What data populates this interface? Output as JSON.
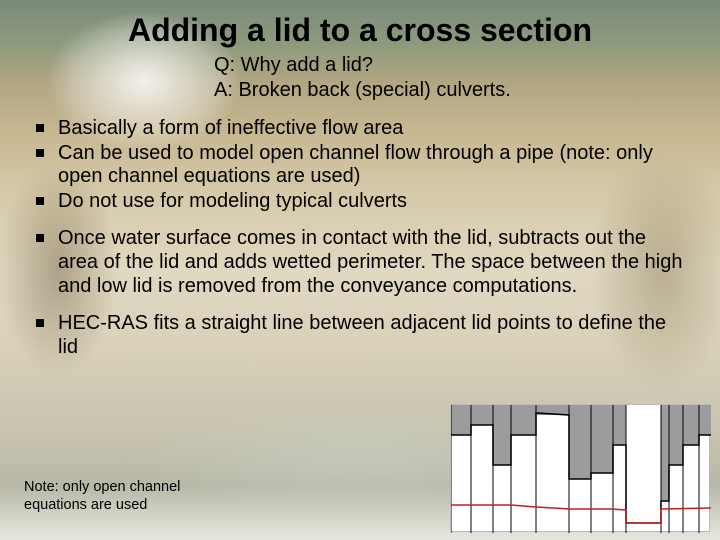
{
  "title": "Adding a lid to a cross section",
  "qa": {
    "q": "Q: Why add a lid?",
    "a": "A: Broken back (special) culverts."
  },
  "bullets": [
    "Basically a form of ineffective flow area",
    "Can be used to model open channel flow through a pipe (note: only open channel equations are used)",
    "Do not use for modeling typical culverts",
    "Once water surface comes in contact with the lid, subtracts out the area of the lid and adds wetted perimeter. The space between the high and low lid is removed from the conveyance computations.",
    "HEC-RAS fits a straight line between adjacent lid points to define the lid"
  ],
  "note": {
    "line1": "Note: only open channel",
    "line2": "equations are used"
  },
  "chart_data": {
    "type": "line",
    "title": "",
    "xlabel": "",
    "ylabel": "",
    "xlim": [
      0,
      260
    ],
    "ylim": [
      0,
      128
    ],
    "series": [
      {
        "name": "ground",
        "color": "#000000",
        "points": [
          [
            0,
            30
          ],
          [
            20,
            30
          ],
          [
            20,
            20
          ],
          [
            42,
            20
          ],
          [
            42,
            60
          ],
          [
            60,
            60
          ],
          [
            60,
            30
          ],
          [
            85,
            30
          ],
          [
            85,
            8
          ],
          [
            118,
            10
          ],
          [
            118,
            74
          ],
          [
            140,
            74
          ],
          [
            140,
            68
          ],
          [
            162,
            68
          ],
          [
            162,
            40
          ],
          [
            175,
            40
          ],
          [
            175,
            118
          ],
          [
            210,
            118
          ],
          [
            210,
            96
          ],
          [
            218,
            96
          ],
          [
            218,
            60
          ],
          [
            232,
            60
          ],
          [
            232,
            40
          ],
          [
            248,
            40
          ],
          [
            248,
            30
          ],
          [
            260,
            30
          ]
        ]
      },
      {
        "name": "lid-fill",
        "color": "#9c9c9c",
        "rects": [
          {
            "x": 0,
            "y": 0,
            "w": 20,
            "h": 30
          },
          {
            "x": 20,
            "y": 0,
            "w": 22,
            "h": 20
          },
          {
            "x": 42,
            "y": 0,
            "w": 18,
            "h": 60
          },
          {
            "x": 60,
            "y": 0,
            "w": 25,
            "h": 30
          },
          {
            "x": 85,
            "y": 0,
            "w": 33,
            "h": 10
          },
          {
            "x": 118,
            "y": 0,
            "w": 22,
            "h": 74
          },
          {
            "x": 140,
            "y": 0,
            "w": 22,
            "h": 68
          },
          {
            "x": 162,
            "y": 0,
            "w": 13,
            "h": 40
          },
          {
            "x": 210,
            "y": 0,
            "w": 8,
            "h": 96
          },
          {
            "x": 218,
            "y": 0,
            "w": 14,
            "h": 60
          },
          {
            "x": 232,
            "y": 0,
            "w": 16,
            "h": 40
          },
          {
            "x": 248,
            "y": 0,
            "w": 12,
            "h": 30
          }
        ]
      },
      {
        "name": "low-lid",
        "color": "#c02020",
        "points": [
          [
            0,
            100
          ],
          [
            60,
            100
          ],
          [
            85,
            102
          ],
          [
            120,
            104
          ],
          [
            160,
            104
          ],
          [
            175,
            105
          ],
          [
            175,
            118
          ],
          [
            210,
            118
          ],
          [
            210,
            104
          ],
          [
            260,
            103
          ]
        ]
      }
    ],
    "verticals": {
      "color": "#000000",
      "x": [
        0,
        20,
        42,
        60,
        85,
        118,
        140,
        162,
        175,
        210,
        218,
        232,
        248
      ]
    }
  }
}
